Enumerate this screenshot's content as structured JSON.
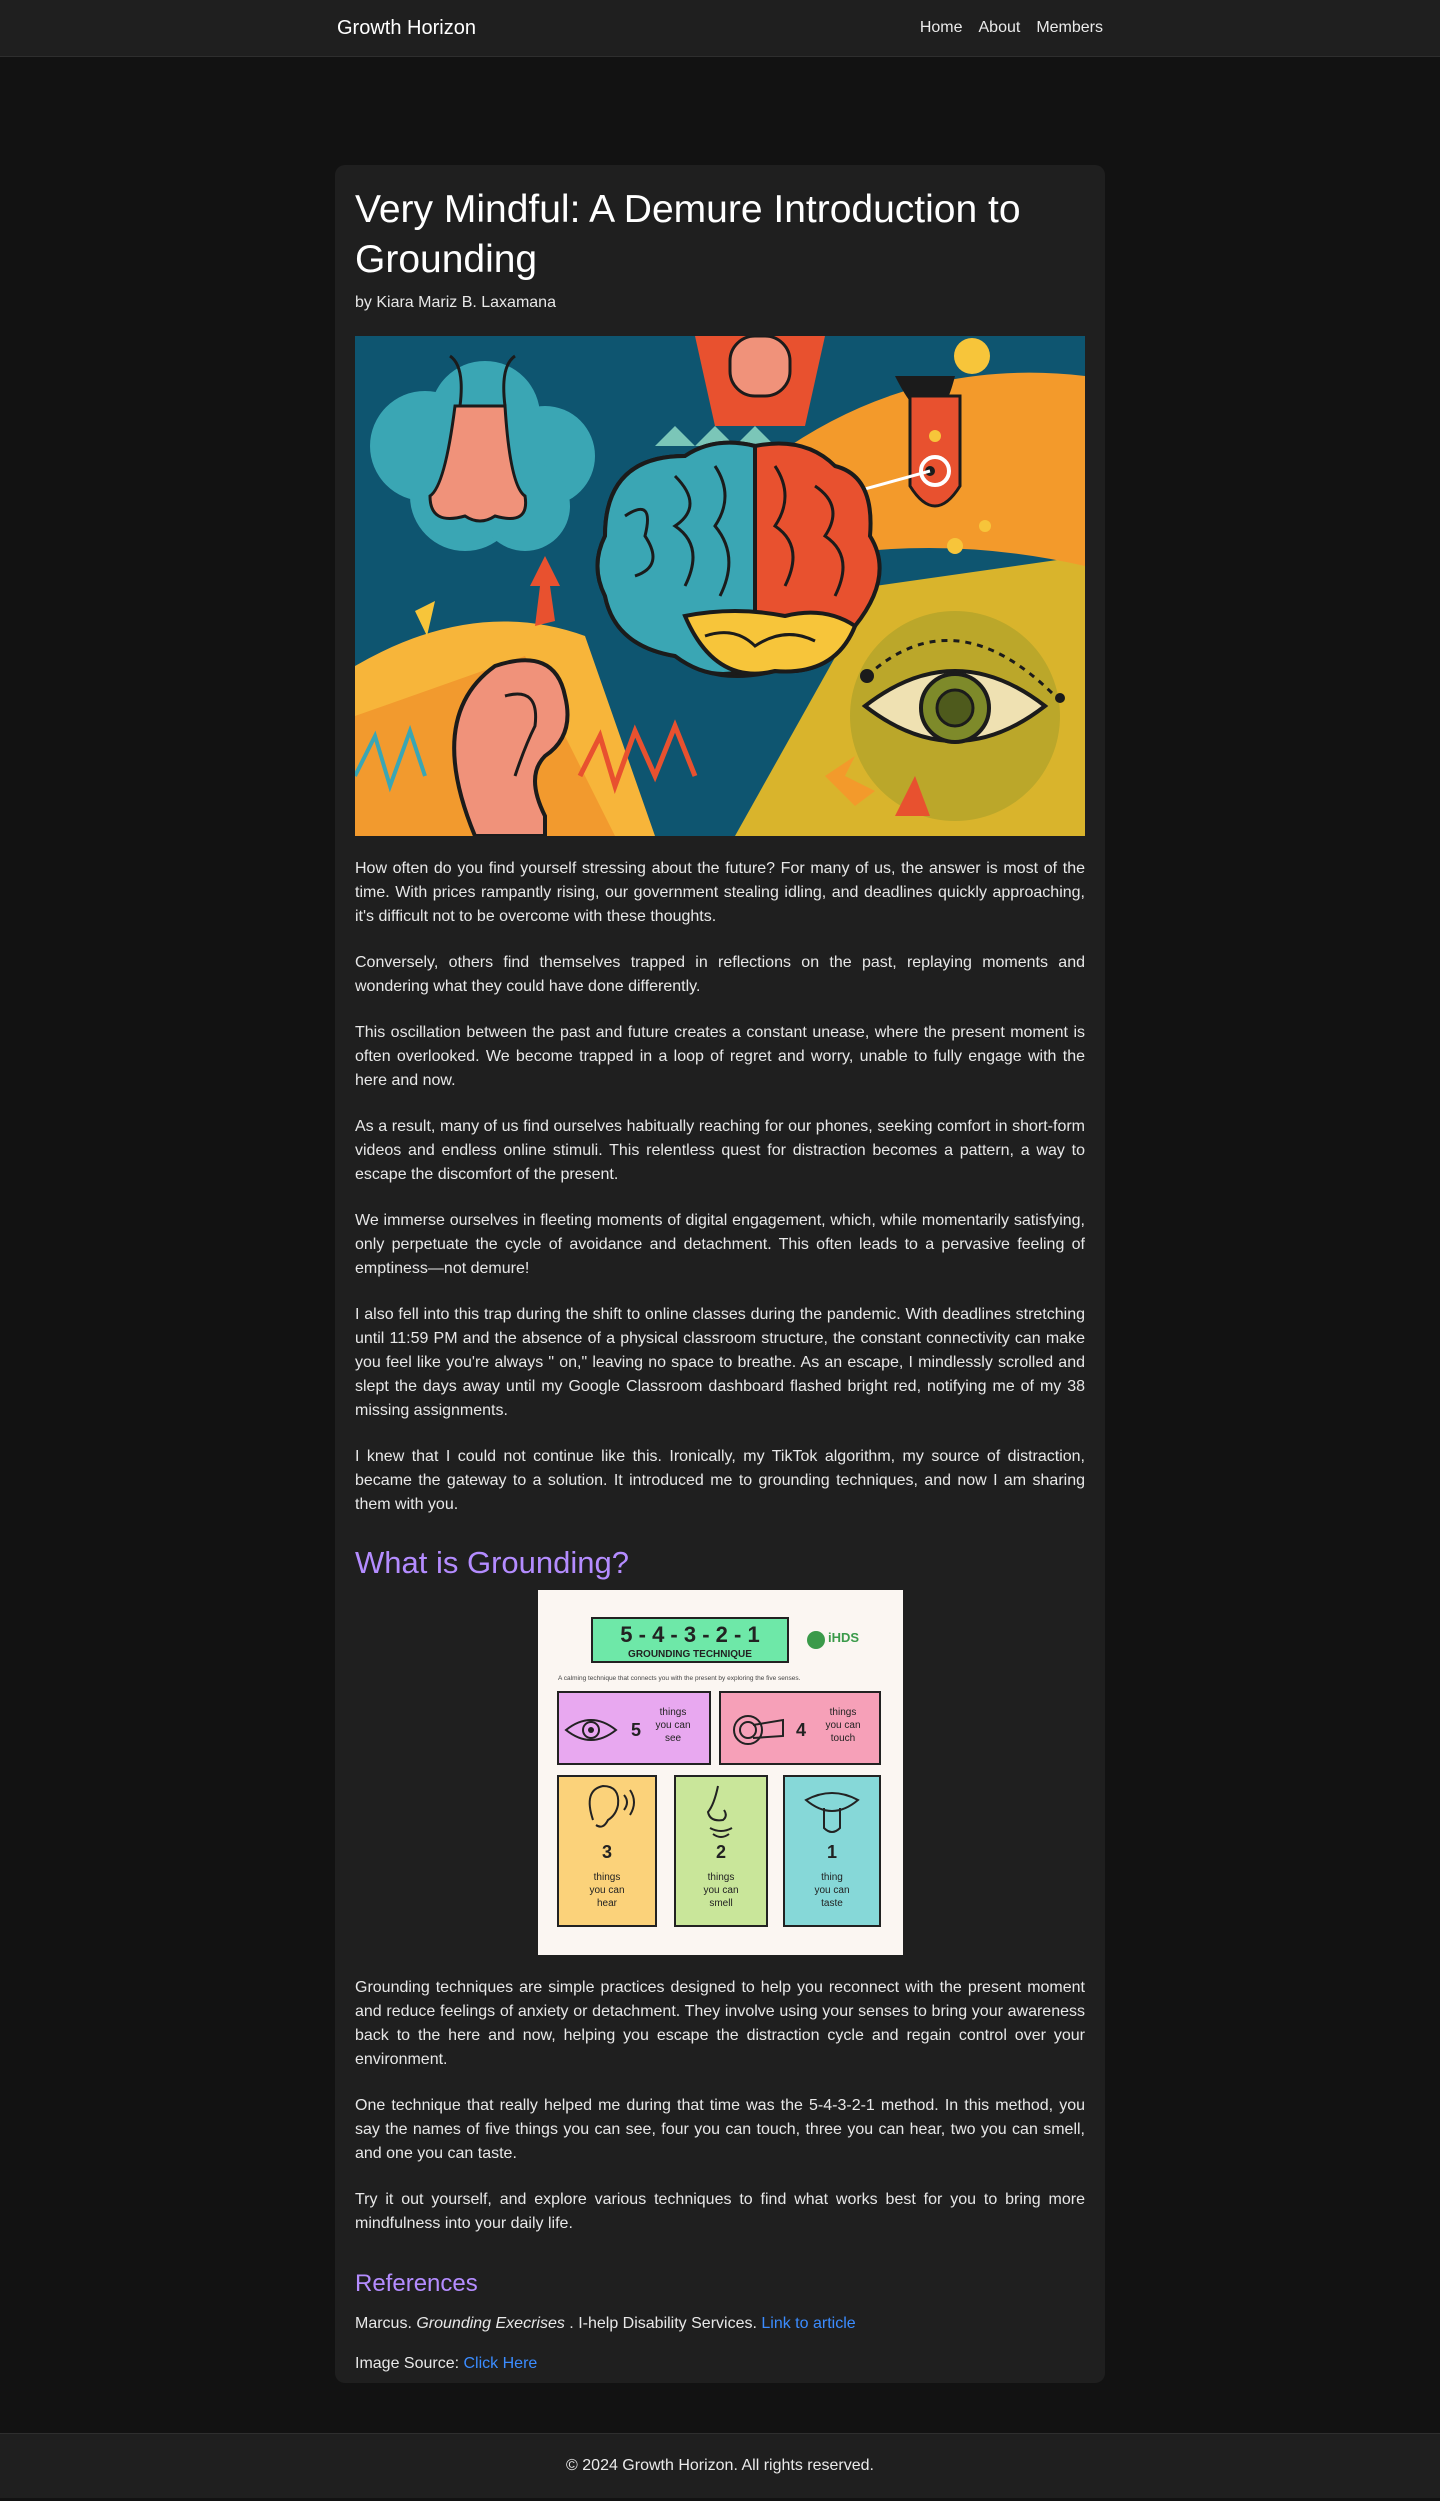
{
  "nav": {
    "brand": "Growth Horizon",
    "links": [
      "Home",
      "About",
      "Members"
    ]
  },
  "article": {
    "title": "Very Mindful: A Demure Introduction to Grounding",
    "author": "by Kiara Mariz B. Laxamana",
    "paragraphs": [
      "How often do you find yourself stressing about the future? For many of us, the answer is most of the time. With prices rampantly rising, our government stealing idling, and deadlines quickly approaching, it's difficult not to be overcome with these thoughts.",
      "Conversely, others find themselves trapped in reflections on the past, replaying moments and wondering what they could have done differently.",
      "This oscillation between the past and future creates a constant unease, where the present moment is often overlooked. We become trapped in a loop of regret and worry, unable to fully engage with the here and now.",
      "As a result, many of us find ourselves habitually reaching for our phones, seeking comfort in short-form videos and endless online stimuli. This relentless quest for distraction becomes a pattern, a way to escape the discomfort of the present.",
      "We immerse ourselves in fleeting moments of digital engagement, which, while momentarily satisfying, only perpetuate the cycle of avoidance and detachment. This often leads to a pervasive feeling of emptiness—not demure!",
      "I also fell into this trap during the shift to online classes during the pandemic. With deadlines stretching until 11:59 PM and the absence of a physical classroom structure, the constant connectivity can make you feel like you're always \" on,\" leaving no space to breathe. As an escape, I mindlessly scrolled and slept the days away until my Google Classroom dashboard flashed bright red, notifying me of my 38 missing assignments.",
      "I knew that I could not continue like this. Ironically, my TikTok algorithm, my source of distraction, became the gateway to a solution. It introduced me to grounding techniques, and now I am sharing them with you."
    ],
    "section_heading": "What is Grounding?",
    "infographic": {
      "title": "5 - 4 - 3 - 2 - 1",
      "subtitle": "GROUNDING TECHNIQUE",
      "logo": "iHDS",
      "caption": "A calming technique that connects you with the present by exploring the five senses.",
      "boxes": [
        {
          "num": "5",
          "text": "things you can see",
          "color": "#e8a8f0"
        },
        {
          "num": "4",
          "text": "things you can touch",
          "color": "#f6a0b8"
        },
        {
          "num": "3",
          "text": "things you can hear",
          "color": "#fbd27a"
        },
        {
          "num": "2",
          "text": "things you can smell",
          "color": "#c9e69a"
        },
        {
          "num": "1",
          "text": "thing you can taste",
          "color": "#86d8d8"
        }
      ]
    },
    "paragraphs2": [
      "Grounding techniques are simple practices designed to help you reconnect with the present moment and reduce feelings of anxiety or detachment. They involve using your senses to bring your awareness back to the here and now, helping you escape the distraction cycle and regain control over your environment.",
      "One technique that really helped me during that time was the 5-4-3-2-1 method. In this method, you say the names of five things you can see, four you can touch, three you can hear, two you can smell, and one you can taste.",
      "Try it out yourself, and explore various techniques to find what works best for you to bring more mindfulness into your daily life."
    ],
    "references": {
      "heading": "References",
      "ref1_prefix": "Marcus. ",
      "ref1_italic": "Grounding Execrises",
      "ref1_suffix": " . I-help Disability Services. ",
      "ref1_link": "Link to article",
      "ref2_prefix": "Image Source: ",
      "ref2_link": "Click Here"
    }
  },
  "footer": {
    "text": "© 2024 Growth Horizon. All rights reserved."
  }
}
